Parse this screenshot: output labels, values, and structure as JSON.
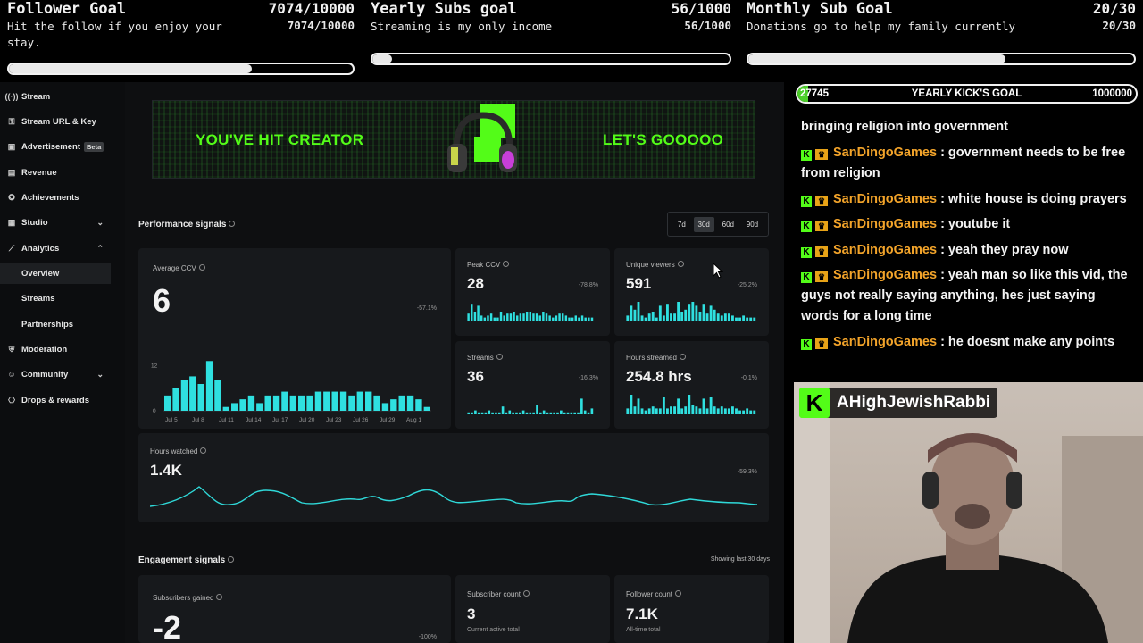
{
  "goals": [
    {
      "title": "Follower Goal",
      "desc": "Hit the follow if you enjoy your stay.",
      "count": "7074/10000",
      "count2": "7074/10000",
      "fill": 0.707
    },
    {
      "title": "Yearly Subs goal",
      "desc": "Streaming is my only income",
      "count": "56/1000",
      "count2": "56/1000",
      "fill": 0.056
    },
    {
      "title": "Monthly Sub Goal",
      "desc": "Donations go to help my family currently",
      "count": "20/30",
      "count2": "20/30",
      "fill": 0.667
    }
  ],
  "sidebar": {
    "items": [
      {
        "label": "Stream",
        "icon": "broadcast-icon"
      },
      {
        "label": "Stream URL & Key",
        "icon": "key-icon"
      },
      {
        "label": "Advertisement",
        "icon": "ad-icon",
        "badge": "Beta"
      },
      {
        "label": "Revenue",
        "icon": "dollar-icon"
      },
      {
        "label": "Achievements",
        "icon": "trophy-icon"
      },
      {
        "label": "Studio",
        "icon": "studio-icon"
      },
      {
        "label": "Analytics",
        "icon": "chart-icon"
      },
      {
        "label": "Overview"
      },
      {
        "label": "Streams"
      },
      {
        "label": "Partnerships"
      },
      {
        "label": "Moderation",
        "icon": "shield-icon"
      },
      {
        "label": "Community",
        "icon": "people-icon"
      },
      {
        "label": "Drops & rewards",
        "icon": "gift-icon"
      }
    ]
  },
  "banner": {
    "left": "YOU'VE HIT CREATOR",
    "right": "LET'S GOOOOO"
  },
  "performance": {
    "title": "Performance signals",
    "ranges": [
      "7d",
      "30d",
      "60d",
      "90d"
    ],
    "selected_range": "30d",
    "average_ccv": {
      "label": "Average CCV",
      "value": "6",
      "delta": "-57.1%",
      "ytick": "12",
      "ytick0": "0",
      "xticks": [
        "Jul 5",
        "Jul 8",
        "Jul 11",
        "Jul 14",
        "Jul 17",
        "Jul 20",
        "Jul 23",
        "Jul 26",
        "Jul 29",
        "Aug 1"
      ],
      "bars": [
        4,
        6,
        8,
        9,
        7,
        13,
        8,
        1,
        2,
        3,
        4,
        2,
        4,
        4,
        5,
        4,
        4,
        4,
        5,
        5,
        5,
        5,
        4,
        5,
        5,
        4,
        2,
        3,
        4,
        4,
        3,
        1
      ]
    },
    "peak_ccv": {
      "label": "Peak CCV",
      "value": "28",
      "delta": "-78.8%"
    },
    "unique_viewers": {
      "label": "Unique viewers",
      "value": "591",
      "delta": "-25.2%"
    },
    "streams": {
      "label": "Streams",
      "value": "36",
      "delta": "-16.3%"
    },
    "hours_streamed": {
      "label": "Hours streamed",
      "value": "254.8 hrs",
      "delta": "-0.1%"
    },
    "hours_watched": {
      "label": "Hours watched",
      "value": "1.4K",
      "delta": "-59.3%"
    }
  },
  "engagement": {
    "title": "Engagement signals",
    "note": "Showing last 30 days",
    "subscribers_gained": {
      "label": "Subscribers gained",
      "value": "-2",
      "delta": "-100%"
    },
    "subscriber_count": {
      "label": "Subscriber count",
      "value": "3",
      "sub": "Current active total"
    },
    "follower_count": {
      "label": "Follower count",
      "value": "7.1K",
      "sub": "All-time total"
    }
  },
  "kick_goal": {
    "current": "27745",
    "title": "YEARLY KICK'S GOAL",
    "target": "1000000",
    "fill": 0.0277
  },
  "chat": [
    {
      "text": "bringing religion into government"
    },
    {
      "user": "SanDingoGames",
      "text": ": government needs to be free from religion"
    },
    {
      "user": "SanDingoGames",
      "text": ": white house is doing prayers"
    },
    {
      "user": "SanDingoGames",
      "text": ": youtube it"
    },
    {
      "user": "SanDingoGames",
      "text": ": yeah they pray now"
    },
    {
      "user": "SanDingoGames",
      "text": ": yeah man so like this vid, the guys not really saying anything, hes just saying words for a long time"
    },
    {
      "user": "SanDingoGames",
      "text": ": he doesnt make any points"
    }
  ],
  "cam": {
    "name": "AHighJewishRabbi",
    "logo": "K"
  }
}
